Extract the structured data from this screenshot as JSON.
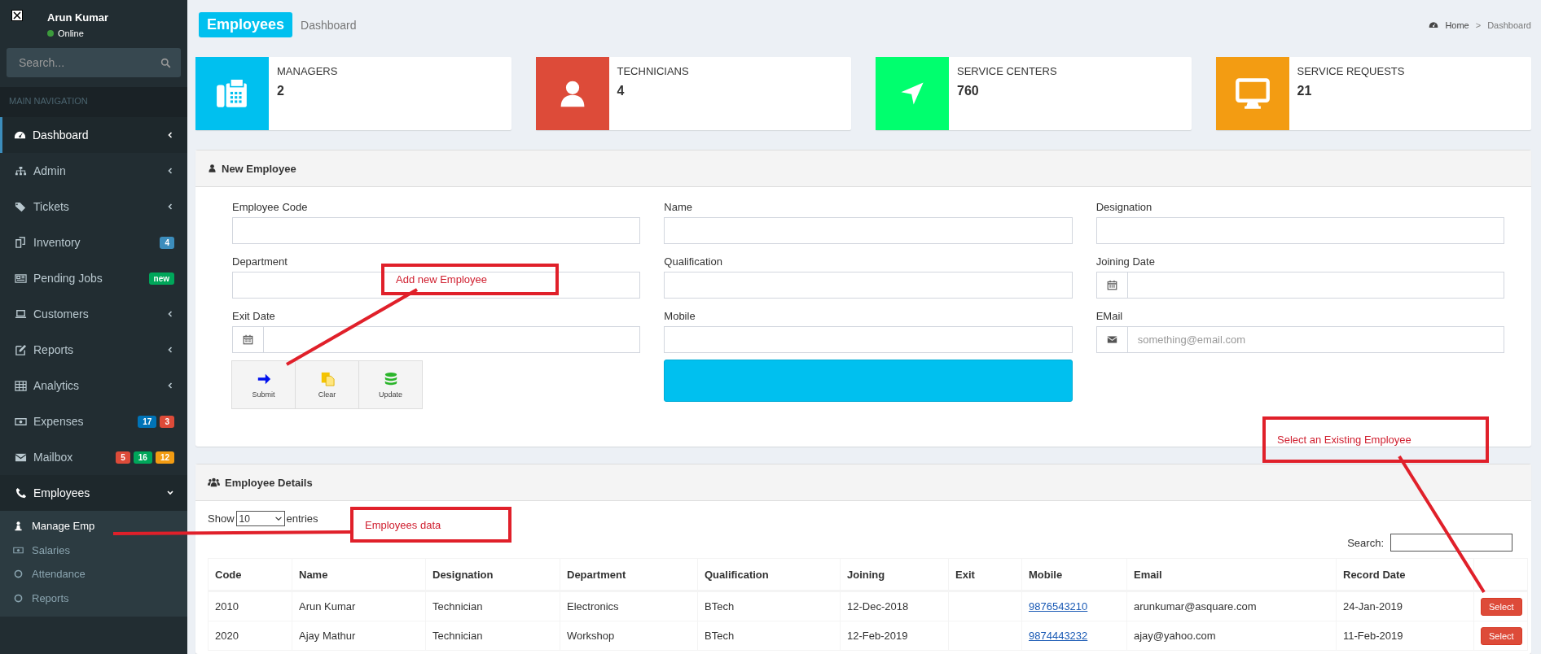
{
  "sidebar": {
    "user": {
      "name": "Arun Kumar",
      "status": "Online"
    },
    "search": {
      "placeholder": "Search..."
    },
    "nav_header": "MAIN NAVIGATION",
    "items": [
      {
        "label": "Dashboard",
        "kind": "submenu",
        "selected": true,
        "expanded": false
      },
      {
        "label": "Admin",
        "kind": "submenu",
        "selected": false,
        "expanded": false
      },
      {
        "label": "Tickets",
        "kind": "submenu",
        "selected": false,
        "expanded": false
      },
      {
        "label": "Inventory",
        "kind": "badges",
        "selected": false,
        "badges": [
          {
            "text": "4",
            "color": "#3c8dbc"
          }
        ]
      },
      {
        "label": "Pending Jobs",
        "kind": "badges",
        "selected": false,
        "badges": [
          {
            "text": "new",
            "color": "#00a65a"
          }
        ]
      },
      {
        "label": "Customers",
        "kind": "submenu",
        "selected": false,
        "expanded": false
      },
      {
        "label": "Reports",
        "kind": "submenu",
        "selected": false,
        "expanded": false
      },
      {
        "label": "Analytics",
        "kind": "submenu",
        "selected": false,
        "expanded": false
      },
      {
        "label": "Expenses",
        "kind": "badges",
        "selected": false,
        "badges": [
          {
            "text": "17",
            "color": "#0073b7"
          },
          {
            "text": "3",
            "color": "#dd4b39"
          }
        ]
      },
      {
        "label": "Mailbox",
        "kind": "badges",
        "selected": false,
        "badges": [
          {
            "text": "5",
            "color": "#dd4b39"
          },
          {
            "text": "16",
            "color": "#00a65a"
          },
          {
            "text": "12",
            "color": "#f39c12"
          }
        ]
      },
      {
        "label": "Employees",
        "kind": "submenu",
        "selected": false,
        "expanded": true,
        "children": [
          {
            "label": "Manage Emp",
            "selected": true
          },
          {
            "label": "Salaries",
            "selected": false
          },
          {
            "label": "Attendance",
            "selected": false
          },
          {
            "label": "Reports",
            "selected": false
          }
        ]
      }
    ]
  },
  "header": {
    "title": "Employees",
    "subtitle": "Dashboard",
    "breadcrumb": [
      "Home",
      "Dashboard"
    ],
    "separator": ">"
  },
  "stats": [
    {
      "label": "MANAGERS",
      "value": "2",
      "color": "#00c0ef"
    },
    {
      "label": "TECHNICIANS",
      "value": "4",
      "color": "#dd4b39"
    },
    {
      "label": "SERVICE CENTERS",
      "value": "760",
      "color": "#00ff6e"
    },
    {
      "label": "SERVICE REQUESTS",
      "value": "21",
      "color": "#f39c12"
    }
  ],
  "new_employee": {
    "title": "New Employee",
    "fields": [
      {
        "label": "Employee Code",
        "kind": "text"
      },
      {
        "label": "Name",
        "kind": "text"
      },
      {
        "label": "Designation",
        "kind": "text"
      },
      {
        "label": "Department",
        "kind": "text"
      },
      {
        "label": "Qualification",
        "kind": "text"
      },
      {
        "label": "Joining Date",
        "kind": "date"
      },
      {
        "label": "Exit Date",
        "kind": "date"
      },
      {
        "label": "Mobile",
        "kind": "text"
      },
      {
        "label": "EMail",
        "kind": "email",
        "placeholder": "something@email.com"
      }
    ],
    "buttons": [
      "Submit",
      "Clear",
      "Update"
    ]
  },
  "employee_details": {
    "title": "Employee Details",
    "show_label": "Show",
    "page_size": "10",
    "entries_label": "entries",
    "search_label": "Search:",
    "columns": [
      "Code",
      "Name",
      "Designation",
      "Department",
      "Qualification",
      "Joining",
      "Exit",
      "Mobile",
      "Email",
      "Record Date"
    ],
    "rows": [
      {
        "cells": [
          "2010",
          "Arun Kumar",
          "Technician",
          "Electronics",
          "BTech",
          "12-Dec-2018",
          "",
          "9876543210",
          "arunkumar@asquare.com",
          "24-Jan-2019"
        ],
        "action": "Select"
      },
      {
        "cells": [
          "2020",
          "Ajay Mathur",
          "Technician",
          "Workshop",
          "BTech",
          "12-Feb-2019",
          "",
          "9874443232",
          "ajay@yahoo.com",
          "11-Feb-2019"
        ],
        "action": "Select"
      }
    ]
  },
  "annotations": [
    "Add new Employee",
    "Employees data",
    "Select an Existing Employee"
  ]
}
